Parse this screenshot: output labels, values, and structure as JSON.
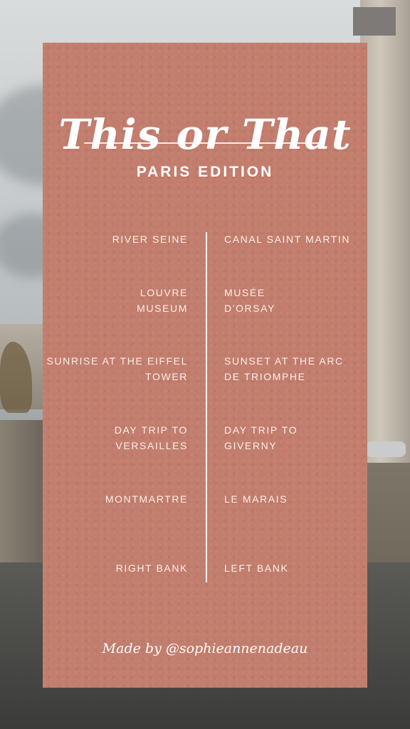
{
  "title": "This or That",
  "subtitle": "PARIS EDITION",
  "pairs": [
    {
      "left": "RIVER SEINE",
      "right": "CANAL SAINT MARTIN"
    },
    {
      "left": "LOUVRE MUSEUM",
      "right": "MUSÉE D'ORSAY"
    },
    {
      "left": "SUNRISE AT THE EIFFEL TOWER",
      "right": "SUNSET AT THE ARC DE TRIOMPHE"
    },
    {
      "left": "DAY TRIP TO VERSAILLES",
      "right": "DAY TRIP TO GIVERNY"
    },
    {
      "left": "MONTMARTRE",
      "right": "LE MARAIS"
    },
    {
      "left": "RIGHT BANK",
      "right": "LEFT BANK"
    }
  ],
  "credit": "Made by @sophieannenadeau",
  "colors": {
    "card": "#c27d6d",
    "text": "#ffffff"
  }
}
